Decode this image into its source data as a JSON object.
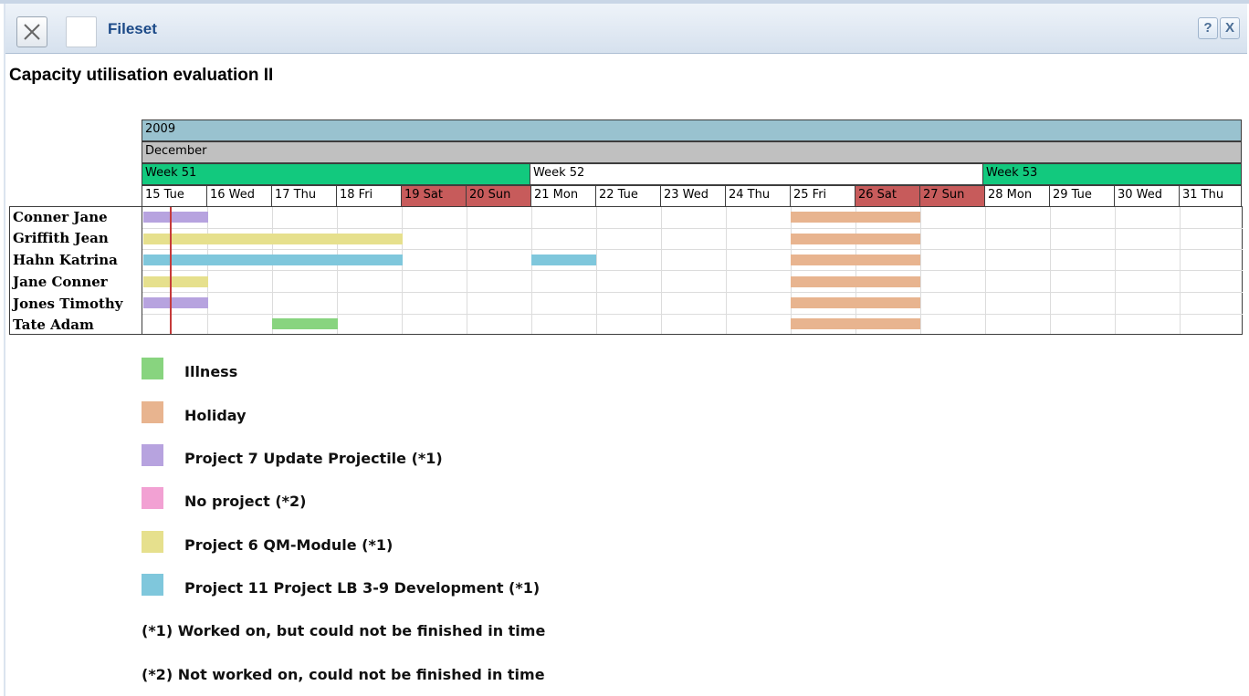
{
  "window": {
    "title": "Fileset",
    "help_label": "?",
    "close_label": "X"
  },
  "page_title": "Capacity utilisation evaluation II",
  "calendar": {
    "year": "2009",
    "month": "December",
    "weeks": [
      "Week 51",
      "Week 52",
      "Week 53"
    ],
    "days": [
      "15 Tue",
      "16 Wed",
      "17 Thu",
      "18 Fri",
      "19 Sat",
      "20 Sun",
      "21 Mon",
      "22 Tue",
      "23 Wed",
      "24 Thu",
      "25 Fri",
      "26 Sat",
      "27 Sun",
      "28 Mon",
      "29 Tue",
      "30 Wed",
      "31 Thu"
    ],
    "colors": {
      "year": "#99c2cf",
      "month": "#c0c0c0",
      "week_active": "#12c97e",
      "weekend": "#c75b5b"
    }
  },
  "employees": [
    "Conner Jane",
    "Griffith Jean",
    "Hahn Katrina",
    "Jane Conner",
    "Jones Timothy",
    "Tate Adam"
  ],
  "legend": [
    {
      "label": "Illness",
      "color": "#88d47f"
    },
    {
      "label": "Holiday",
      "color": "#e8b48f"
    },
    {
      "label": "Project 7 Update Projectile (*1)",
      "color": "#b7a3df"
    },
    {
      "label": "No project (*2)",
      "color": "#f2a1d3"
    },
    {
      "label": "Project 6 QM-Module (*1)",
      "color": "#e6e08d"
    },
    {
      "label": "Project 11 Project LB 3-9 Development (*1)",
      "color": "#7fc7dc"
    }
  ],
  "notes": [
    "(*1) Worked on, but could not be finished in time",
    "(*2) Not worked on, could not be finished in time"
  ]
}
